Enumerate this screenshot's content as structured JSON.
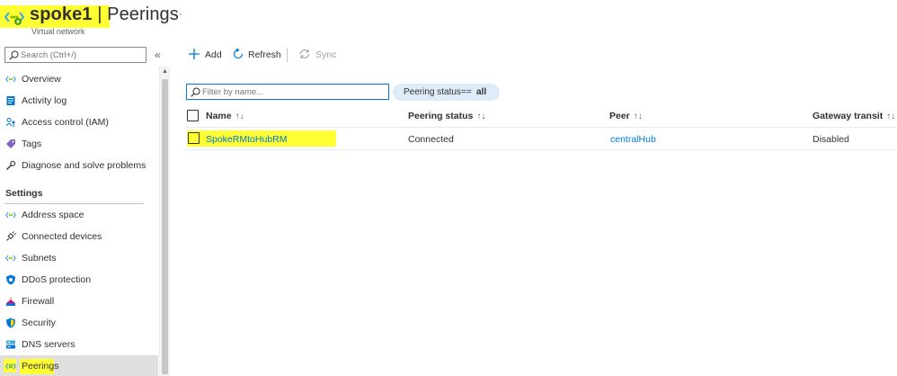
{
  "header": {
    "resource_name": "spoke1",
    "separator": " | ",
    "page_name": "Peerings",
    "subtitle": "Virtual network",
    "more_label": "···",
    "icon": "vnet-icon"
  },
  "sidebar": {
    "search_placeholder": "Search (Ctrl+/)",
    "collapse_label": "«",
    "items_top": [
      {
        "label": "Overview",
        "icon": "vnet-icon"
      },
      {
        "label": "Activity log",
        "icon": "activity-log-icon"
      },
      {
        "label": "Access control (IAM)",
        "icon": "iam-icon"
      },
      {
        "label": "Tags",
        "icon": "tag-icon"
      },
      {
        "label": "Diagnose and solve problems",
        "icon": "wrench-icon"
      }
    ],
    "section_label": "Settings",
    "items_settings": [
      {
        "label": "Address space",
        "icon": "vnet-icon"
      },
      {
        "label": "Connected devices",
        "icon": "plug-icon"
      },
      {
        "label": "Subnets",
        "icon": "vnet-icon"
      },
      {
        "label": "DDoS protection",
        "icon": "shield-icon"
      },
      {
        "label": "Firewall",
        "icon": "firewall-icon"
      },
      {
        "label": "Security",
        "icon": "security-shield-icon"
      },
      {
        "label": "DNS servers",
        "icon": "dns-icon"
      },
      {
        "label": "Peerings",
        "icon": "peering-icon",
        "active": true
      }
    ]
  },
  "toolbar": {
    "add_label": "Add",
    "refresh_label": "Refresh",
    "sync_label": "Sync"
  },
  "filter": {
    "placeholder": "Filter by name...",
    "pill_key": "Peering status",
    "pill_op": "==",
    "pill_value": "all"
  },
  "table": {
    "columns": [
      "Name",
      "Peering status",
      "Peer",
      "Gateway transit"
    ],
    "sort_glyph": "↑↓",
    "rows": [
      {
        "name": "SpokeRMtoHubRM",
        "status": "Connected",
        "peer": "centralHub",
        "gateway_transit": "Disabled"
      }
    ]
  },
  "colors": {
    "highlight": "#ffff33",
    "link": "#0078d4",
    "pill_bg": "#deecf9",
    "active_nav_bg": "#e1dfdd"
  }
}
